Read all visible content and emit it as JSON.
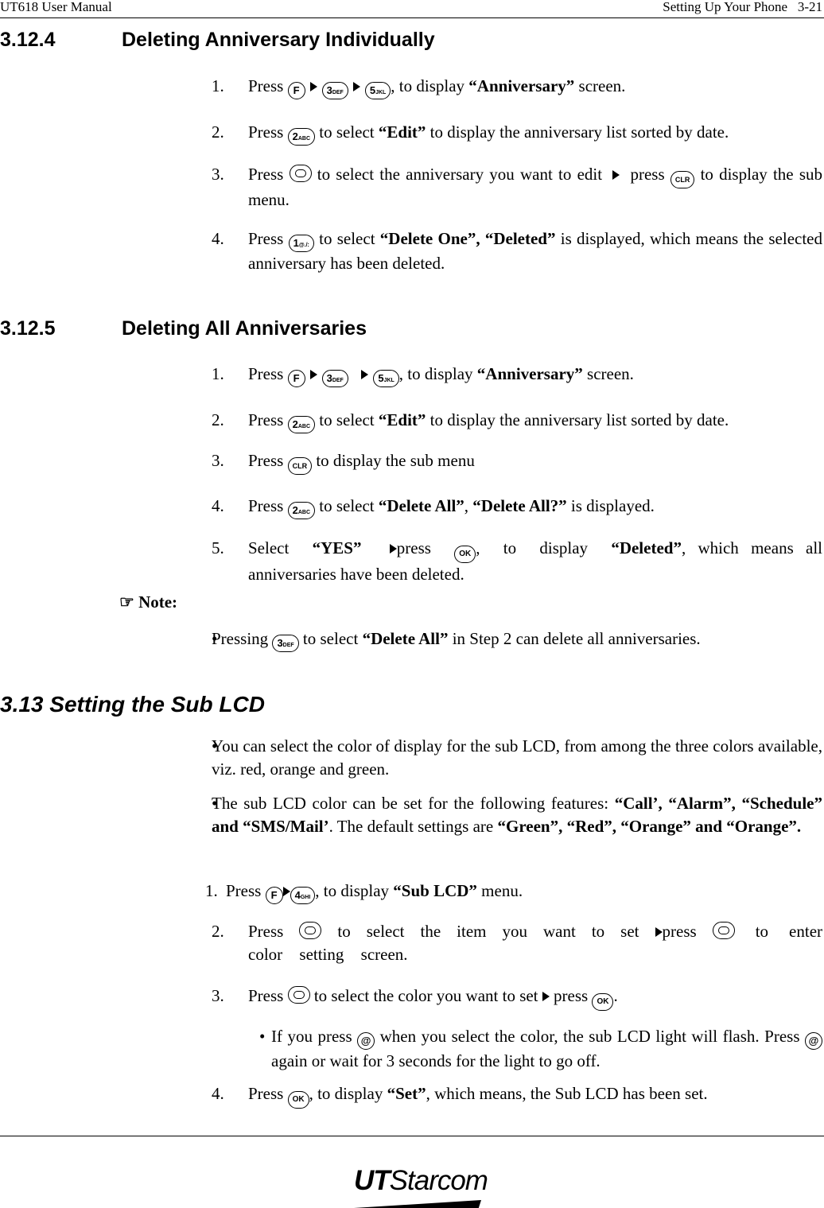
{
  "header": {
    "left": "UT618 User Manual",
    "right": "Setting Up Your Phone   3-21"
  },
  "sec1": {
    "num": "3.12.4",
    "title": "Deleting Anniversary Individually",
    "steps": [
      {
        "n": "1.",
        "a": "Press",
        "b": ", to display ",
        "c": "“Anniversary”",
        "d": " screen."
      },
      {
        "n": "2.",
        "a": "Press",
        "b": " to select ",
        "c": "“Edit”",
        "d": " to display the anniversary list sorted by date."
      },
      {
        "n": "3.",
        "a": "Press",
        "b": "  to select the anniversary you want to edit ",
        "c": " press ",
        "d": " to display the sub menu."
      },
      {
        "n": "4.",
        "a": "Press",
        "b": " to select ",
        "c": "“Delete One”, “Deleted”",
        "d": " is displayed, which means the selected anniversary has been deleted."
      }
    ]
  },
  "sec2": {
    "num": "3.12.5",
    "title": "Deleting All Anniversaries",
    "steps": [
      {
        "n": "1.",
        "a": "Press",
        "b": ", to display ",
        "c": "“Anniversary”",
        "d": " screen."
      },
      {
        "n": "2.",
        "a": "Press",
        "b": " to select ",
        "c": "“Edit”",
        "d": " to display the anniversary list sorted by date."
      },
      {
        "n": "3.",
        "a": "Press",
        "b": " to display the sub menu"
      },
      {
        "n": "4.",
        "a": "Press",
        "b": " to select ",
        "c": "“Delete All”",
        "d": ", ",
        "e": "“Delete All?”",
        "f": " is displayed."
      },
      {
        "n": "5.",
        "a": "Select ",
        "b": "“YES”",
        "c": "press ",
        "d": ", to display ",
        "e": "“Deleted”",
        "f": ", which means all anniversaries have been deleted."
      }
    ],
    "note_label": "Note:",
    "note_icon": "hand-pointer-icon",
    "note_item": {
      "a": "Pressing",
      "b": "  to select ",
      "c": "“Delete All”",
      "d": " in Step 2 can delete all anniversaries."
    }
  },
  "sec3": {
    "title": "3.13 Setting the Sub LCD",
    "bullets": [
      {
        "a": "You can select the color of display for the sub LCD, from among the three colors available, viz. red, orange and green."
      },
      {
        "a": "The sub LCD color can be set for the following features: ",
        "b": "“Call’, “Alarm”, “Schedule” and “SMS/Mail’",
        "c": ". The default settings are ",
        "d": "“Green”, “Red”, “Orange” and “Orange”."
      }
    ],
    "steps": [
      {
        "n": "1.",
        "a": "Press",
        "b": ", to display ",
        "c": "“Sub LCD”",
        "d": " menu."
      },
      {
        "n": "2.",
        "a": "Press",
        "b": "  to select the item you want to set ",
        "c": "press",
        "d": "  to enter color setting screen."
      },
      {
        "n": "3.",
        "a": "Press",
        "b": "  to select the color you want to set ",
        "c": " press ",
        "d": "."
      },
      {
        "n": "4.",
        "a": "Press",
        "b": ", to display ",
        "c": "“Set”",
        "d": ", which means, the Sub LCD has been set."
      }
    ],
    "sub_bullet": {
      "a": "If you press ",
      "b": " when you select the color, the sub LCD light will flash. Press ",
      "c": " again or wait for 3 seconds for the light to go off."
    }
  },
  "keys": {
    "f": "F",
    "k3": "3",
    "k3s": "DEF",
    "k5": "5",
    "k5s": "JKL",
    "k2": "2",
    "k2s": "ABC",
    "k1": "1",
    "k1s": "@./:",
    "k4": "4",
    "k4s": "GHI",
    "clr": "CLR",
    "ok": "OK",
    "at": "@"
  },
  "footer": {
    "logo_bold": "UT",
    "logo_rest": "Starcom"
  }
}
